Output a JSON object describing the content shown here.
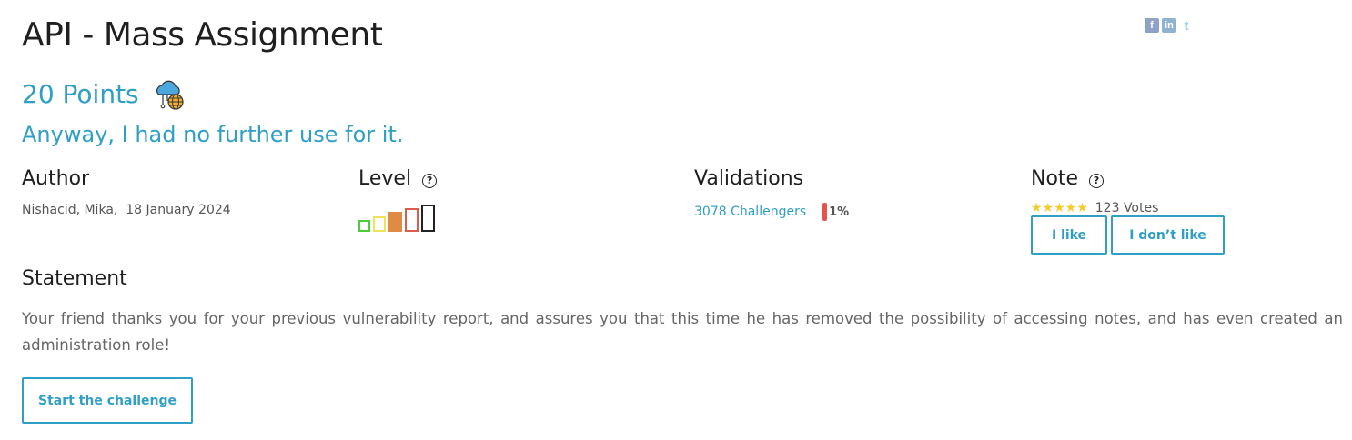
{
  "title": "API - Mass Assignment",
  "social": {
    "facebook": "f",
    "linkedin": "in",
    "twitter": "t"
  },
  "points": "20 Points",
  "category_icon": "cloud-globe-icon",
  "subtitle": "Anyway, I had no further use for it.",
  "author": {
    "label": "Author",
    "value": "Nishacid, Mika,  18 January 2024"
  },
  "level": {
    "label": "Level",
    "help": "?",
    "current_level": 3,
    "max_level": 5
  },
  "validations": {
    "label": "Validations",
    "challengers": "3078 Challengers",
    "percent": "1%"
  },
  "note": {
    "label": "Note",
    "help": "?",
    "stars": "★★★★★",
    "votes": "123 Votes",
    "like": "I like",
    "dislike": "I don’t like"
  },
  "statement": {
    "label": "Statement",
    "text": "Your friend thanks you for your previous vulnerability report, and assures you that this time he has removed the possibility of accessing notes, and has even created an administration role!"
  },
  "start_button": "Start the challenge",
  "colors": {
    "accent": "#2f9fc6",
    "level_colors": [
      "#4ccc3a",
      "#f2e25a",
      "#e08b43",
      "#dd5b4a",
      "#222222"
    ],
    "percent_bar": "#e8524a",
    "star": "#f5cc2e"
  }
}
